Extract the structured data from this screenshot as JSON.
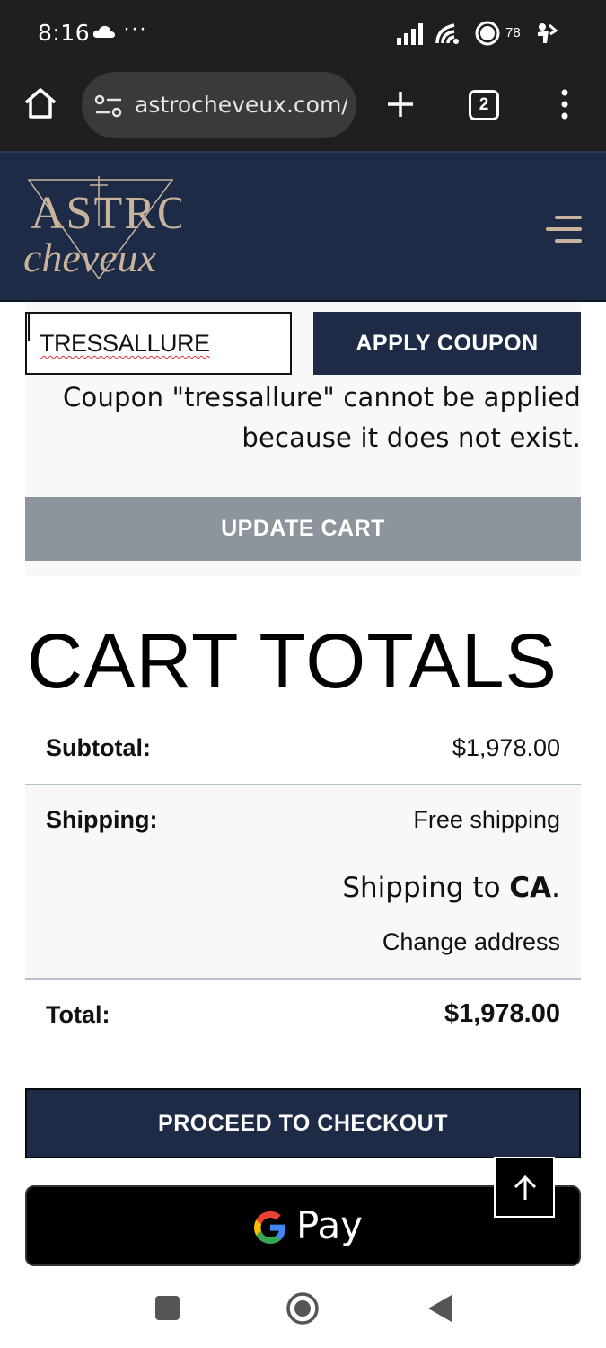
{
  "status_bar": {
    "time": "8:16",
    "dots": "···",
    "battery_level": "78"
  },
  "browser": {
    "url": "astrocheveux.com/c",
    "tab_count": "2"
  },
  "site": {
    "logo_top": "ASTRO",
    "logo_bottom": "cheveux"
  },
  "coupon": {
    "input_value": "TRESSALLURE",
    "apply_label": "APPLY COUPON",
    "error_message": "Coupon \"tressallure\" cannot be applied because it does not exist.",
    "update_label": "UPDATE CART"
  },
  "cart_totals": {
    "title": "CART TOTALS",
    "subtotal_label": "Subtotal:",
    "subtotal_value": "$1,978.00",
    "shipping_label": "Shipping:",
    "shipping_method": "Free shipping",
    "shipping_to_prefix": "Shipping to ",
    "shipping_to_region": "CA",
    "shipping_to_suffix": ".",
    "change_address": "Change address",
    "total_label": "Total:",
    "total_value": "$1,978.00"
  },
  "actions": {
    "checkout_label": "PROCEED TO CHECKOUT",
    "gpay_label": "Pay"
  },
  "colors": {
    "brand_navy": "#1d2b46",
    "update_gray": "#8e949c"
  }
}
